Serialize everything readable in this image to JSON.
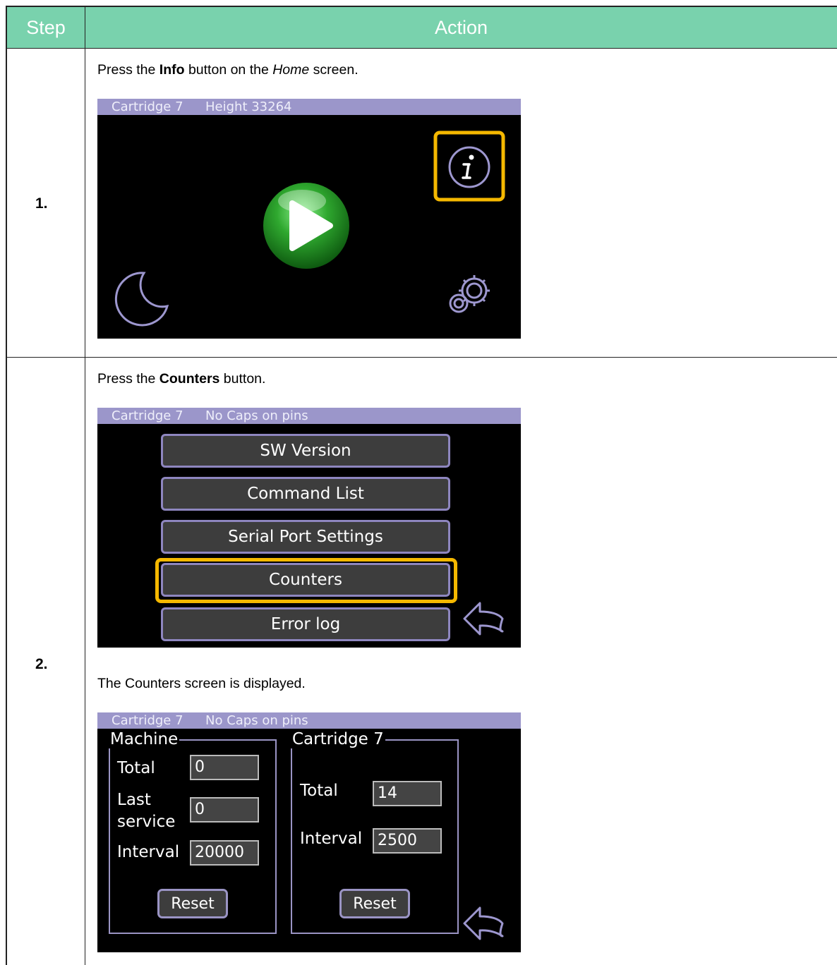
{
  "header": {
    "step": "Step",
    "action": "Action"
  },
  "steps": [
    {
      "number": "1.",
      "instruction": {
        "before": "Press the ",
        "button": "Info",
        "middle": " button on the ",
        "screen": "Home",
        "after": " screen."
      },
      "screen": {
        "status_left": "Cartridge 7",
        "status_right": "Height 33264"
      }
    },
    {
      "number": "2.",
      "instruction": {
        "before": "Press the ",
        "button": "Counters",
        "after": " button."
      },
      "screen": {
        "status_left": "Cartridge 7",
        "status_right": "No Caps on pins",
        "menu": [
          "SW Version",
          "Command List",
          "Serial Port Settings",
          "Counters",
          "Error log"
        ]
      },
      "result_text": "The Counters screen is displayed.",
      "counters_screen": {
        "status_left": "Cartridge 7",
        "status_right": "No Caps on pins",
        "machine": {
          "title": "Machine",
          "total_label": "Total",
          "total_value": "0",
          "last_service_label_1": "Last",
          "last_service_label_2": "service",
          "last_service_value": "0",
          "interval_label": "Interval",
          "interval_value": "20000",
          "reset": "Reset"
        },
        "cartridge": {
          "title": "Cartridge 7",
          "total_label": "Total",
          "total_value": "14",
          "interval_label": "Interval",
          "interval_value": "2500",
          "reset": "Reset"
        }
      }
    }
  ],
  "colors": {
    "header_bg": "#79d2ad",
    "status_bar": "#9b96ca",
    "highlight": "#f5b800",
    "play_green": "#2fa82f",
    "icon_purple": "#9d97cf"
  },
  "icons": [
    "info-icon",
    "play-icon",
    "moon-icon",
    "gears-icon",
    "back-arrow-icon"
  ]
}
